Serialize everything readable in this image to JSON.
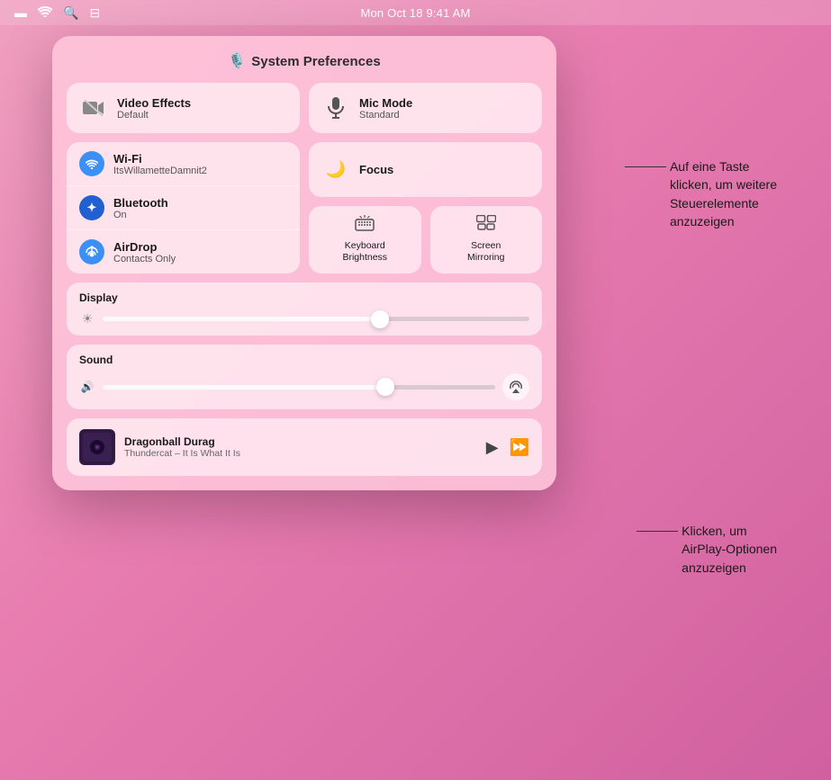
{
  "menubar": {
    "time": "Mon Oct 18  9:41 AM",
    "battery_icon": "🔋",
    "wifi_icon": "WiFi",
    "search_icon": "🔍",
    "control_icon": "⊟"
  },
  "panel": {
    "title": "System Preferences",
    "title_icon": "🎙️",
    "video_effects": {
      "title": "Video Effects",
      "subtitle": "Default",
      "icon": "📷"
    },
    "mic_mode": {
      "title": "Mic Mode",
      "subtitle": "Standard",
      "icon": "🎙️"
    },
    "wifi": {
      "title": "Wi-Fi",
      "subtitle": "ItsWillametteDamnit2",
      "icon": "wifi"
    },
    "bluetooth": {
      "title": "Bluetooth",
      "subtitle": "On",
      "icon": "bluetooth"
    },
    "airdrop": {
      "title": "AirDrop",
      "subtitle": "Contacts Only",
      "icon": "airdrop"
    },
    "focus": {
      "title": "Focus",
      "icon": "moon"
    },
    "keyboard_brightness": {
      "title": "Keyboard",
      "title2": "Brightness",
      "icon": "☀️"
    },
    "screen_mirroring": {
      "title": "Screen",
      "title2": "Mirroring",
      "icon": "⧉"
    },
    "display": {
      "label": "Display",
      "slider_value": 65,
      "sun_icon": "☀️"
    },
    "sound": {
      "label": "Sound",
      "slider_value": 72,
      "sound_icon": "🔊"
    },
    "now_playing": {
      "title": "Dragonball Durag",
      "artist": "Thundercat – It Is What It Is",
      "play_icon": "▶",
      "skip_icon": "⏩",
      "album_emoji": "🎵"
    }
  },
  "callouts": {
    "callout1": "Auf eine Taste\nklicken, um weitere\nSteuerelemente\nanzuzeigen",
    "callout2": "Klicken, um\nAirPlay-Optionen\nanzuzeigen"
  }
}
